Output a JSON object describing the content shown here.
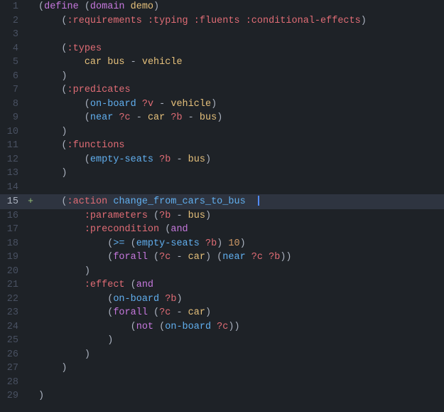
{
  "editor": {
    "background": "#1e2227",
    "lines": [
      {
        "num": 1,
        "active": false,
        "plus": false,
        "tokens": [
          {
            "t": "(",
            "c": "paren"
          },
          {
            "t": "define",
            "c": "kw-define"
          },
          {
            "t": " (",
            "c": "paren"
          },
          {
            "t": "domain",
            "c": "kw-domain"
          },
          {
            "t": " demo",
            "c": "ident-domain"
          },
          {
            "t": ")",
            "c": "paren"
          }
        ]
      },
      {
        "num": 2,
        "active": false,
        "plus": false,
        "tokens": [
          {
            "t": "    (",
            "c": "paren"
          },
          {
            "t": ":requirements",
            "c": "kw-req"
          },
          {
            "t": " ",
            "c": ""
          },
          {
            "t": ":typing",
            "c": "kw-req"
          },
          {
            "t": " ",
            "c": ""
          },
          {
            "t": ":fluents",
            "c": "kw-req"
          },
          {
            "t": " ",
            "c": ""
          },
          {
            "t": ":conditional-effects",
            "c": "kw-req"
          },
          {
            "t": ")",
            "c": "paren"
          }
        ]
      },
      {
        "num": 3,
        "active": false,
        "plus": false,
        "tokens": []
      },
      {
        "num": 4,
        "active": false,
        "plus": false,
        "tokens": [
          {
            "t": "    (",
            "c": "paren"
          },
          {
            "t": ":types",
            "c": "kw-req"
          }
        ]
      },
      {
        "num": 5,
        "active": false,
        "plus": false,
        "tokens": [
          {
            "t": "        ",
            "c": ""
          },
          {
            "t": "car",
            "c": "type-name"
          },
          {
            "t": " ",
            "c": ""
          },
          {
            "t": "bus",
            "c": "type-name"
          },
          {
            "t": " - ",
            "c": "dash"
          },
          {
            "t": "vehicle",
            "c": "type-name"
          }
        ]
      },
      {
        "num": 6,
        "active": false,
        "plus": false,
        "tokens": [
          {
            "t": "    ",
            "c": ""
          },
          {
            "t": ")",
            "c": "paren"
          }
        ]
      },
      {
        "num": 7,
        "active": false,
        "plus": false,
        "tokens": [
          {
            "t": "    (",
            "c": "paren"
          },
          {
            "t": ":predicates",
            "c": "kw-req"
          }
        ]
      },
      {
        "num": 8,
        "active": false,
        "plus": false,
        "tokens": [
          {
            "t": "        (",
            "c": "paren"
          },
          {
            "t": "on-board",
            "c": "pred-name"
          },
          {
            "t": " ",
            "c": ""
          },
          {
            "t": "?v",
            "c": "var"
          },
          {
            "t": " - ",
            "c": "dash"
          },
          {
            "t": "vehicle",
            "c": "type-name"
          },
          {
            "t": ")",
            "c": "paren"
          }
        ]
      },
      {
        "num": 9,
        "active": false,
        "plus": false,
        "tokens": [
          {
            "t": "        (",
            "c": "paren"
          },
          {
            "t": "near",
            "c": "pred-name"
          },
          {
            "t": " ",
            "c": ""
          },
          {
            "t": "?c",
            "c": "var"
          },
          {
            "t": " - ",
            "c": "dash"
          },
          {
            "t": "car",
            "c": "type-name"
          },
          {
            "t": " ",
            "c": ""
          },
          {
            "t": "?b",
            "c": "var"
          },
          {
            "t": " - ",
            "c": "dash"
          },
          {
            "t": "bus",
            "c": "type-name"
          },
          {
            "t": ")",
            "c": "paren"
          }
        ]
      },
      {
        "num": 10,
        "active": false,
        "plus": false,
        "tokens": [
          {
            "t": "    ",
            "c": ""
          },
          {
            "t": ")",
            "c": "paren"
          }
        ]
      },
      {
        "num": 11,
        "active": false,
        "plus": false,
        "tokens": [
          {
            "t": "    (",
            "c": "paren"
          },
          {
            "t": ":functions",
            "c": "kw-req"
          }
        ]
      },
      {
        "num": 12,
        "active": false,
        "plus": false,
        "tokens": [
          {
            "t": "        (",
            "c": "paren"
          },
          {
            "t": "empty-seats",
            "c": "pred-name"
          },
          {
            "t": " ",
            "c": ""
          },
          {
            "t": "?b",
            "c": "var"
          },
          {
            "t": " - ",
            "c": "dash"
          },
          {
            "t": "bus",
            "c": "type-name"
          },
          {
            "t": ")",
            "c": "paren"
          }
        ]
      },
      {
        "num": 13,
        "active": false,
        "plus": false,
        "tokens": [
          {
            "t": "    ",
            "c": ""
          },
          {
            "t": ")",
            "c": "paren"
          }
        ]
      },
      {
        "num": 14,
        "active": false,
        "plus": false,
        "tokens": []
      },
      {
        "num": 15,
        "active": true,
        "plus": true,
        "tokens": [
          {
            "t": "    (",
            "c": "paren"
          },
          {
            "t": ":action",
            "c": "kw-req"
          },
          {
            "t": " ",
            "c": ""
          },
          {
            "t": "change_from_cars_to_bus",
            "c": "action-name"
          },
          {
            "t": "  ",
            "c": ""
          },
          {
            "t": "CURSOR",
            "c": "cursor"
          }
        ]
      },
      {
        "num": 16,
        "active": false,
        "plus": false,
        "tokens": [
          {
            "t": "        ",
            "c": ""
          },
          {
            "t": ":parameters",
            "c": "kw-req"
          },
          {
            "t": " (",
            "c": "paren"
          },
          {
            "t": "?b",
            "c": "var"
          },
          {
            "t": " - ",
            "c": "dash"
          },
          {
            "t": "bus",
            "c": "type-name"
          },
          {
            "t": ")",
            "c": "paren"
          }
        ]
      },
      {
        "num": 17,
        "active": false,
        "plus": false,
        "tokens": [
          {
            "t": "        ",
            "c": ""
          },
          {
            "t": ":precondition",
            "c": "kw-req"
          },
          {
            "t": " (",
            "c": "paren"
          },
          {
            "t": "and",
            "c": "logic-kw"
          },
          {
            "t": "",
            "c": "paren"
          }
        ]
      },
      {
        "num": 18,
        "active": false,
        "plus": false,
        "tokens": [
          {
            "t": "            (",
            "c": "paren"
          },
          {
            "t": ">=",
            "c": "pred-name"
          },
          {
            "t": " (",
            "c": "paren"
          },
          {
            "t": "empty-seats",
            "c": "pred-name"
          },
          {
            "t": " ",
            "c": ""
          },
          {
            "t": "?b",
            "c": "var"
          },
          {
            "t": ") ",
            "c": "paren"
          },
          {
            "t": "10",
            "c": "num"
          },
          {
            "t": ")",
            "c": "paren"
          }
        ]
      },
      {
        "num": 19,
        "active": false,
        "plus": false,
        "tokens": [
          {
            "t": "            (",
            "c": "paren"
          },
          {
            "t": "forall",
            "c": "logic-kw"
          },
          {
            "t": " (",
            "c": "paren"
          },
          {
            "t": "?c",
            "c": "var"
          },
          {
            "t": " - ",
            "c": "dash"
          },
          {
            "t": "car",
            "c": "type-name"
          },
          {
            "t": ") (",
            "c": "paren"
          },
          {
            "t": "near",
            "c": "pred-name"
          },
          {
            "t": " ",
            "c": ""
          },
          {
            "t": "?c",
            "c": "var"
          },
          {
            "t": " ",
            "c": ""
          },
          {
            "t": "?b",
            "c": "var"
          },
          {
            "t": "))",
            "c": "paren"
          }
        ]
      },
      {
        "num": 20,
        "active": false,
        "plus": false,
        "tokens": [
          {
            "t": "        ",
            "c": ""
          },
          {
            "t": ")",
            "c": "paren"
          }
        ]
      },
      {
        "num": 21,
        "active": false,
        "plus": false,
        "tokens": [
          {
            "t": "        ",
            "c": ""
          },
          {
            "t": ":effect",
            "c": "kw-req"
          },
          {
            "t": " (",
            "c": "paren"
          },
          {
            "t": "and",
            "c": "logic-kw"
          }
        ]
      },
      {
        "num": 22,
        "active": false,
        "plus": false,
        "tokens": [
          {
            "t": "            (",
            "c": "paren"
          },
          {
            "t": "on-board",
            "c": "pred-name"
          },
          {
            "t": " ",
            "c": ""
          },
          {
            "t": "?b",
            "c": "var"
          },
          {
            "t": ")",
            "c": "paren"
          }
        ]
      },
      {
        "num": 23,
        "active": false,
        "plus": false,
        "tokens": [
          {
            "t": "            (",
            "c": "paren"
          },
          {
            "t": "forall",
            "c": "logic-kw"
          },
          {
            "t": " (",
            "c": "paren"
          },
          {
            "t": "?c",
            "c": "var"
          },
          {
            "t": " - ",
            "c": "dash"
          },
          {
            "t": "car",
            "c": "type-name"
          },
          {
            "t": ")",
            "c": "paren"
          }
        ]
      },
      {
        "num": 24,
        "active": false,
        "plus": false,
        "tokens": [
          {
            "t": "                (",
            "c": "paren"
          },
          {
            "t": "not",
            "c": "logic-kw"
          },
          {
            "t": " (",
            "c": "paren"
          },
          {
            "t": "on-board",
            "c": "pred-name"
          },
          {
            "t": " ",
            "c": ""
          },
          {
            "t": "?c",
            "c": "var"
          },
          {
            "t": "))",
            "c": "paren"
          }
        ]
      },
      {
        "num": 25,
        "active": false,
        "plus": false,
        "tokens": [
          {
            "t": "            ",
            "c": ""
          },
          {
            "t": ")",
            "c": "paren"
          }
        ]
      },
      {
        "num": 26,
        "active": false,
        "plus": false,
        "tokens": [
          {
            "t": "        ",
            "c": ""
          },
          {
            "t": ")",
            "c": "paren"
          }
        ]
      },
      {
        "num": 27,
        "active": false,
        "plus": false,
        "tokens": [
          {
            "t": "    ",
            "c": ""
          },
          {
            "t": ")",
            "c": "paren"
          }
        ]
      },
      {
        "num": 28,
        "active": false,
        "plus": false,
        "tokens": []
      },
      {
        "num": 29,
        "active": false,
        "plus": false,
        "tokens": [
          {
            "t": ")",
            "c": "paren"
          }
        ]
      }
    ]
  }
}
